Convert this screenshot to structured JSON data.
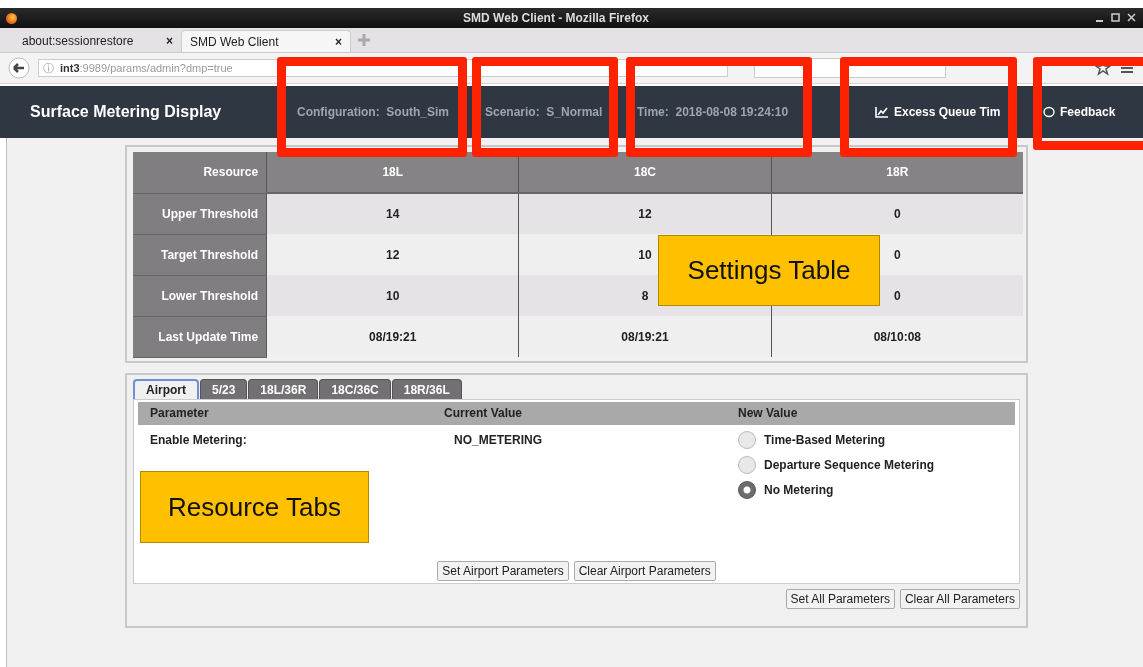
{
  "browser": {
    "title": "SMD Web Client - Mozilla Firefox",
    "tabs": [
      {
        "label": "about:sessionrestore",
        "close": "×",
        "selected": false
      },
      {
        "label": "SMD Web Client",
        "close": "×",
        "selected": true
      }
    ],
    "url": {
      "info": "ⓘ",
      "host": "int3",
      "path": ":9989/params/admin?dmp=true"
    }
  },
  "header": {
    "title": "Surface Metering Display",
    "items": [
      {
        "kind": "field",
        "label": "Configuration:",
        "value": "South_Sim"
      },
      {
        "kind": "field",
        "label": "Scenario:",
        "value": "S_Normal"
      },
      {
        "kind": "field",
        "label": "Time:",
        "value": "2018-08-08 19:24:10"
      },
      {
        "kind": "chart",
        "label": "Excess Queue Tim"
      },
      {
        "kind": "comment",
        "label": "Feedback"
      }
    ]
  },
  "settings_table": {
    "columns": [
      "Resource",
      "18L",
      "18C",
      "18R"
    ],
    "rows": [
      [
        "Upper Threshold",
        "14",
        "12",
        "0"
      ],
      [
        "Target Threshold",
        "12",
        "10",
        "0"
      ],
      [
        "Lower Threshold",
        "10",
        "8",
        "0"
      ],
      [
        "Last Update Time",
        "08/19:21",
        "08/19:21",
        "08/10:08"
      ]
    ]
  },
  "resource_tabs": [
    {
      "label": "Airport",
      "selected": true
    },
    {
      "label": "5/23",
      "selected": false
    },
    {
      "label": "18L/36R",
      "selected": false
    },
    {
      "label": "18C/36C",
      "selected": false
    },
    {
      "label": "18R/36L",
      "selected": false
    }
  ],
  "parameters": {
    "columns": [
      "Parameter",
      "Current Value",
      "New Value"
    ],
    "rows": [
      {
        "name": "Enable Metering:",
        "current": "NO_METERING",
        "options": [
          {
            "label": "Time-Based Metering",
            "selected": false
          },
          {
            "label": "Departure Sequence Metering",
            "selected": false
          },
          {
            "label": "No Metering",
            "selected": true
          }
        ]
      }
    ],
    "buttons": [
      "Set Airport Parameters",
      "Clear Airport Parameters"
    ]
  },
  "buttons": [
    "Set All Parameters",
    "Clear All Parameters"
  ],
  "annotations": [
    {
      "kind": "highlight"
    },
    {
      "kind": "highlight"
    },
    {
      "kind": "highlight"
    },
    {
      "kind": "highlight"
    },
    {
      "kind": "highlight"
    },
    {
      "kind": "callout",
      "text": "Settings Table"
    },
    {
      "kind": "callout",
      "text": "Resource Tabs"
    }
  ]
}
